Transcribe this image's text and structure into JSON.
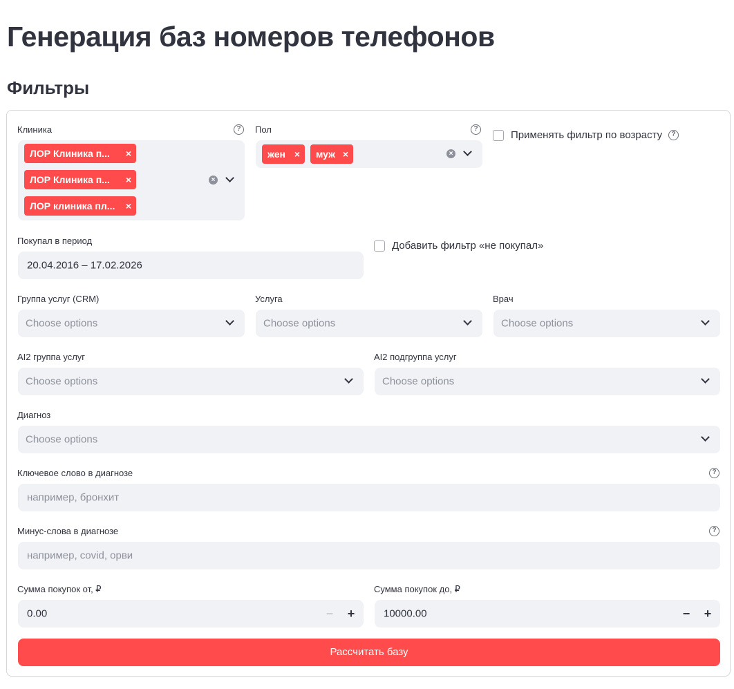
{
  "page": {
    "title": "Генерация баз номеров телефонов",
    "section_title": "Фильтры"
  },
  "filters": {
    "clinic": {
      "label": "Клиника",
      "help": "?",
      "tags": [
        "ЛОР Клиника п...",
        "ЛОР Клиника п...",
        "ЛОР клиника пл..."
      ],
      "tag_remove": "×",
      "clear": "×"
    },
    "gender": {
      "label": "Пол",
      "help": "?",
      "tags": [
        "жен",
        "муж"
      ],
      "tag_remove": "×",
      "clear": "×"
    },
    "age_filter": {
      "label": "Применять фильтр по возрасту",
      "help": "?",
      "checked": false
    },
    "period": {
      "label": "Покупал в период",
      "value": "20.04.2016 – 17.02.2026"
    },
    "not_bought": {
      "label": "Добавить фильтр «не покупал»",
      "checked": false
    },
    "service_group_crm": {
      "label": "Группа услуг (CRM)",
      "placeholder": "Choose options"
    },
    "service": {
      "label": "Услуга",
      "placeholder": "Choose options"
    },
    "doctor": {
      "label": "Врач",
      "placeholder": "Choose options"
    },
    "ai2_group": {
      "label": "AI2 группа услуг",
      "placeholder": "Choose options"
    },
    "ai2_subgroup": {
      "label": "AI2 подгруппа услуг",
      "placeholder": "Choose options"
    },
    "diagnosis": {
      "label": "Диагноз",
      "placeholder": "Choose options"
    },
    "keyword": {
      "label": "Ключевое слово в диагнозе",
      "placeholder": "например, бронхит",
      "help": "?"
    },
    "minus_words": {
      "label": "Минус-слова в диагнозе",
      "placeholder": "например, covid, орви",
      "help": "?"
    },
    "sum_from": {
      "label": "Сумма покупок от, ₽",
      "value": "0.00",
      "minus": "−",
      "plus": "+"
    },
    "sum_to": {
      "label": "Сумма покупок до, ₽",
      "value": "10000.00",
      "minus": "−",
      "plus": "+"
    }
  },
  "submit": {
    "label": "Рассчитать базу"
  },
  "colors": {
    "accent": "#ff4b4b",
    "field_bg": "#f0f2f6",
    "text": "#31333f",
    "placeholder": "#8e919b"
  }
}
